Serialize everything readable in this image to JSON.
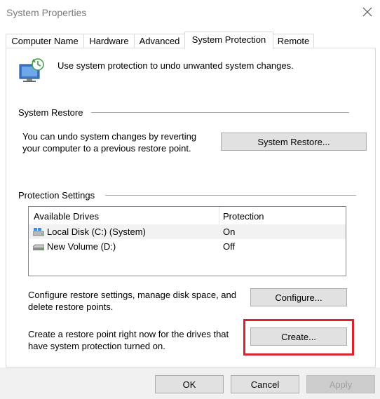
{
  "window": {
    "title": "System Properties"
  },
  "tabs": [
    {
      "label": "Computer Name",
      "active": false
    },
    {
      "label": "Hardware",
      "active": false
    },
    {
      "label": "Advanced",
      "active": false
    },
    {
      "label": "System Protection",
      "active": true
    },
    {
      "label": "Remote",
      "active": false
    }
  ],
  "intro": {
    "text": "Use system protection to undo unwanted system changes.",
    "icon": "system-protection-icon"
  },
  "system_restore": {
    "heading": "System Restore",
    "line1": "You can undo system changes by reverting",
    "line2": "your computer to a previous restore point.",
    "button_label": "System Restore..."
  },
  "protection": {
    "heading": "Protection Settings",
    "columns": [
      "Available Drives",
      "Protection"
    ],
    "rows": [
      {
        "drive": "Local Disk (C:) (System)",
        "protection": "On",
        "icon": "system-drive-icon",
        "selected": true
      },
      {
        "drive": "New Volume (D:)",
        "protection": "Off",
        "icon": "drive-icon",
        "selected": false
      }
    ],
    "configure_line1": "Configure restore settings, manage disk space, and",
    "configure_line2": "delete restore points.",
    "configure_label": "Configure...",
    "create_line1": "Create a restore point right now for the drives that",
    "create_line2": "have system protection turned on.",
    "create_label": "Create..."
  },
  "footer": {
    "ok": "OK",
    "cancel": "Cancel",
    "apply": "Apply"
  },
  "colors": {
    "highlight": "#d9232e",
    "button_face": "#e1e1e1",
    "selected_row": "#f2f2f2"
  }
}
